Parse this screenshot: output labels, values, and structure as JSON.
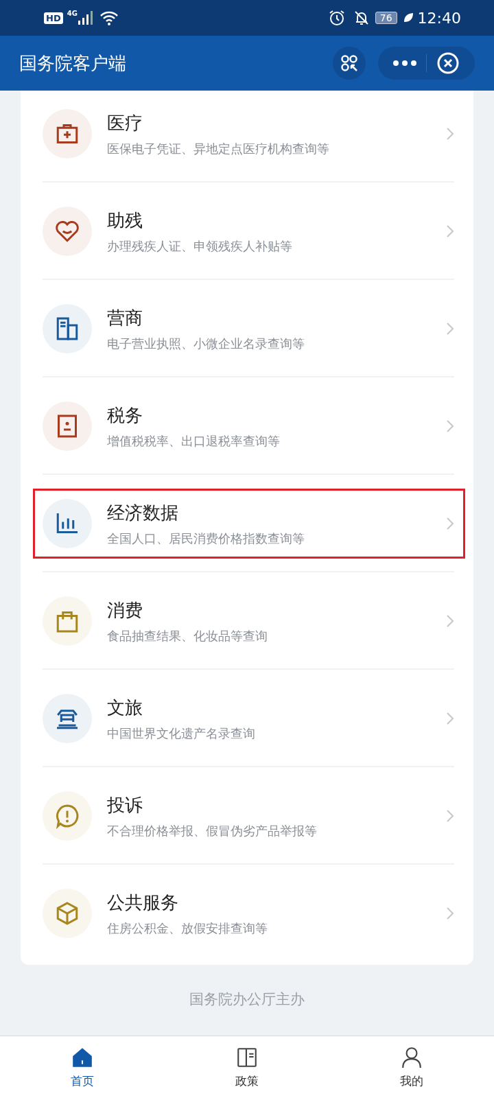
{
  "status_bar": {
    "hd": "HD",
    "network": "4G",
    "battery": "76",
    "time": "12:40"
  },
  "app_bar": {
    "title": "国务院客户端"
  },
  "services": [
    {
      "title": "医疗",
      "subtitle": "医保电子凭证、异地定点医疗机构查询等",
      "kind": "medical",
      "color": "#a83a1e",
      "highlighted": false
    },
    {
      "title": "助残",
      "subtitle": "办理残疾人证、申领残疾人补贴等",
      "kind": "heart",
      "color": "#a83a1e",
      "highlighted": false
    },
    {
      "title": "营商",
      "subtitle": "电子营业执照、小微企业名录查询等",
      "kind": "building",
      "color": "#1a5a9a",
      "highlighted": false
    },
    {
      "title": "税务",
      "subtitle": "增值税税率、出口退税率查询等",
      "kind": "badge",
      "color": "#a83a1e",
      "highlighted": false
    },
    {
      "title": "经济数据",
      "subtitle": "全国人口、居民消费价格指数查询等",
      "kind": "chart",
      "color": "#1a5a9a",
      "highlighted": true
    },
    {
      "title": "消费",
      "subtitle": "食品抽查结果、化妆品等查询",
      "kind": "bag",
      "color": "#a8861e",
      "highlighted": false
    },
    {
      "title": "文旅",
      "subtitle": "中国世界文化遗产名录查询",
      "kind": "temple",
      "color": "#1a5a9a",
      "highlighted": false
    },
    {
      "title": "投诉",
      "subtitle": "不合理价格举报、假冒伪劣产品举报等",
      "kind": "alert",
      "color": "#a8861e",
      "highlighted": false
    },
    {
      "title": "公共服务",
      "subtitle": "住房公积金、放假安排查询等",
      "kind": "box",
      "color": "#a8861e",
      "highlighted": false
    }
  ],
  "footer": "国务院办公厅主办",
  "tabs": [
    {
      "label": "首页",
      "kind": "home",
      "selected": true
    },
    {
      "label": "政策",
      "kind": "book",
      "selected": false
    },
    {
      "label": "我的",
      "kind": "person",
      "selected": false
    }
  ]
}
